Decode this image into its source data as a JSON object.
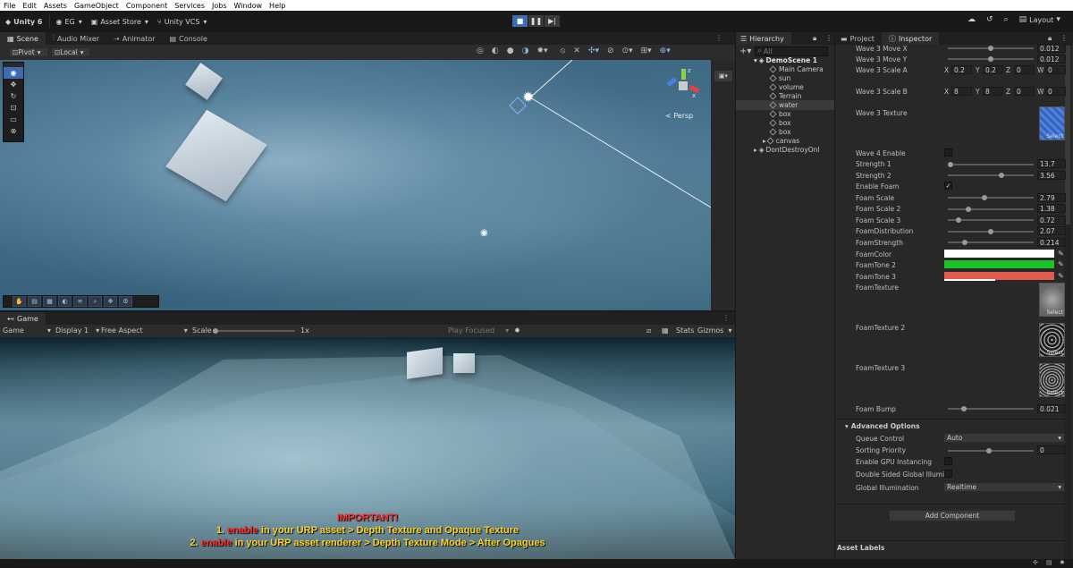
{
  "menu": [
    "File",
    "Edit",
    "Assets",
    "GameObject",
    "Component",
    "Services",
    "Jobs",
    "Window",
    "Help"
  ],
  "toolbar": {
    "unity": "Unity 6",
    "account": "EG",
    "asset_store": "Asset Store",
    "vcs": "Unity VCS",
    "layout": "Layout"
  },
  "scene_tabs": [
    "Scene",
    "Audio Mixer",
    "Animator",
    "Console"
  ],
  "scene_toolbar": {
    "pivot": "Pivot",
    "local": "Local"
  },
  "scene_view": {
    "persp": "< Persp",
    "axes": {
      "y": "y",
      "z": "z",
      "x": "x"
    }
  },
  "game": {
    "tab": "Game",
    "mode": "Game",
    "display": "Display 1",
    "aspect": "Free Aspect",
    "scale_label": "Scale",
    "scale_value": "1x",
    "play_focused": "Play Focused",
    "stats": "Stats",
    "gizmos": "Gizmos",
    "warning_title": "IMPORTANT!",
    "line1_prefix": "1. ",
    "line1_enable": "enable",
    "line1_rest": " in your URP asset > Depth Texture and Opaque Texture",
    "line2_prefix": "2. ",
    "line2_enable": "enable",
    "line2_rest": " in your URP asset renderer > Depth Texture Mode > After Opagues"
  },
  "hierarchy": {
    "tab": "Hierarchy",
    "search": "All",
    "scene": "DemoScene 1",
    "items": [
      "Main Camera",
      "sun",
      "volume",
      "Terrain",
      "water",
      "box",
      "box",
      "box",
      "canvas"
    ],
    "dont_destroy": "DontDestroyOnl"
  },
  "inspector": {
    "tabs": [
      "Project",
      "Inspector"
    ],
    "wave3_move_x": {
      "label": "Wave 3 Move X",
      "value": "0.012"
    },
    "wave3_move_y": {
      "label": "Wave 3 Move Y",
      "value": "0.012"
    },
    "wave3_scale_a": {
      "label": "Wave 3 Scale A",
      "x": "0.2",
      "y": "0.2",
      "z": "0",
      "w": "0"
    },
    "wave3_scale_b": {
      "label": "Wave 3 Scale B",
      "x": "8",
      "y": "8",
      "z": "0",
      "w": "0"
    },
    "wave3_texture": "Wave 3 Texture",
    "select": "Select",
    "wave4_enable": "Wave 4 Enable",
    "strength1": {
      "label": "Strength 1",
      "value": "13.7"
    },
    "strength2": {
      "label": "Strength 2",
      "value": "3.56"
    },
    "enable_foam": "Enable Foam",
    "foam_scale": {
      "label": "Foam Scale",
      "value": "2.79"
    },
    "foam_scale2": {
      "label": "Foam Scale 2",
      "value": "1.38"
    },
    "foam_scale3": {
      "label": "Foam Scale 3",
      "value": "0.72"
    },
    "foam_distribution": {
      "label": "FoamDistribution",
      "value": "2.07"
    },
    "foam_strength": {
      "label": "FoamStrength",
      "value": "0.214"
    },
    "foam_color": {
      "label": "FoamColor",
      "color": "#ffffff"
    },
    "foam_tone2": {
      "label": "FoamTone 2",
      "color": "#18c42a"
    },
    "foam_tone3": {
      "label": "FoamTone 3",
      "color": "#e05a4e"
    },
    "foam_texture": "FoamTexture",
    "foam_texture2": "FoamTexture 2",
    "foam_texture3": "FoamTexture 3",
    "foam_bump": {
      "label": "Foam Bump",
      "value": "0.021"
    },
    "advanced": "Advanced Options",
    "queue_control": {
      "label": "Queue Control",
      "value": "Auto"
    },
    "sorting_priority": {
      "label": "Sorting Priority",
      "value": "0"
    },
    "gpu_instancing": "Enable GPU Instancing",
    "double_sided": "Double Sided Global Illumin",
    "global_illum": {
      "label": "Global Illumination",
      "value": "Realtime"
    },
    "add_component": "Add Component",
    "asset_labels": "Asset Labels"
  },
  "colors": {
    "accent": "#3d6db0",
    "warning_red": "#ff2a2a",
    "warning_yellow": "#ffd21e"
  }
}
